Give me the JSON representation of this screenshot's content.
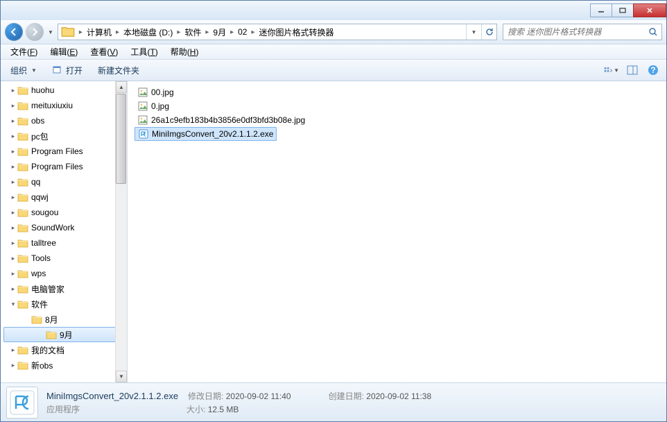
{
  "breadcrumbs": [
    "计算机",
    "本地磁盘 (D:)",
    "软件",
    "9月",
    "02",
    "迷你图片格式转换器"
  ],
  "search": {
    "placeholder": "搜索 迷你图片格式转换器"
  },
  "menus": [
    {
      "label": "文件",
      "accel": "F"
    },
    {
      "label": "编辑",
      "accel": "E"
    },
    {
      "label": "查看",
      "accel": "V"
    },
    {
      "label": "工具",
      "accel": "T"
    },
    {
      "label": "帮助",
      "accel": "H"
    }
  ],
  "toolbar": {
    "organize": "组织",
    "open": "打开",
    "newfolder": "新建文件夹"
  },
  "sidebar": {
    "items": [
      {
        "label": "huohu",
        "depth": 1
      },
      {
        "label": "meituxiuxiu",
        "depth": 1
      },
      {
        "label": "obs",
        "depth": 1
      },
      {
        "label": "pc包",
        "depth": 1
      },
      {
        "label": "Program Files",
        "depth": 1
      },
      {
        "label": "Program Files",
        "depth": 1
      },
      {
        "label": "qq",
        "depth": 1
      },
      {
        "label": "qqwj",
        "depth": 1
      },
      {
        "label": "sougou",
        "depth": 1
      },
      {
        "label": "SoundWork",
        "depth": 1
      },
      {
        "label": "talltree",
        "depth": 1
      },
      {
        "label": "Tools",
        "depth": 1
      },
      {
        "label": "wps",
        "depth": 1
      },
      {
        "label": "电脑管家",
        "depth": 1
      },
      {
        "label": "软件",
        "depth": 1,
        "expanded": true
      },
      {
        "label": "8月",
        "depth": 2
      },
      {
        "label": "9月",
        "depth": 2,
        "selected": true
      },
      {
        "label": "我的文档",
        "depth": 1
      },
      {
        "label": "新obs",
        "depth": 1
      }
    ]
  },
  "files": [
    {
      "name": "00.jpg",
      "type": "image"
    },
    {
      "name": "0.jpg",
      "type": "image"
    },
    {
      "name": "26a1c9efb183b4b3856e0df3bfd3b08e.jpg",
      "type": "image"
    },
    {
      "name": "MiniImgsConvert_20v2.1.1.2.exe",
      "type": "exe",
      "selected": true
    }
  ],
  "status": {
    "filename": "MiniImgsConvert_20v2.1.1.2.exe",
    "filetype": "应用程序",
    "modified_label": "修改日期:",
    "modified_value": "2020-09-02 11:40",
    "created_label": "创建日期:",
    "created_value": "2020-09-02 11:38",
    "size_label": "大小:",
    "size_value": "12.5 MB"
  }
}
